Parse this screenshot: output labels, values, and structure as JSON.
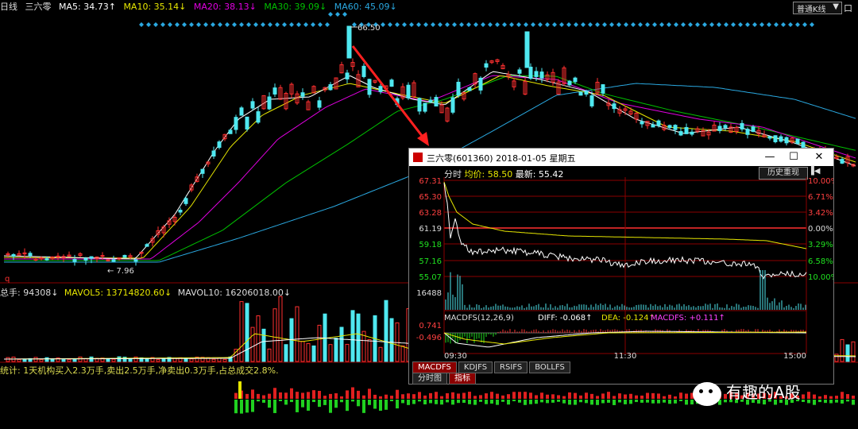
{
  "top": {
    "period": "日线",
    "name": "三六零",
    "ma5": "MA5: 34.73↑",
    "ma10": "MA10: 35.14↓",
    "ma20": "MA20: 38.13↓",
    "ma30": "MA30: 39.09↓",
    "ma60": "MA60: 45.09↓",
    "chart_mode": "普通K线",
    "chart_mode_arrow": "▼",
    "right_btn": "口"
  },
  "colors": {
    "ma5": "#ffffff",
    "ma10": "#e6e600",
    "ma20": "#e000e0",
    "ma30": "#00c000",
    "ma60": "#2aa8e0",
    "up": "#ff3030",
    "down": "#4fe8f0",
    "grid": "#8b0000"
  },
  "main_chart": {
    "high_label": "66.50",
    "low_label": "7.96",
    "marker": "q"
  },
  "volume": {
    "total": "总手: 94308↓",
    "mavol5": "MAVOL5: 13714820.60↓",
    "mavol10": "MAVOL10: 16206018.00↓"
  },
  "stats": {
    "text": "统计: 1天机构买入2.3万手,卖出2.5万手,净卖出0.3万手,占总成交2.8%."
  },
  "popup": {
    "title": "三六零(601360)  2018-01-05  星期五",
    "minimize": "—",
    "maximize": "☐",
    "close": "✕",
    "sub_prefix": "分时",
    "sub_avg": "均价: 58.50",
    "sub_last": "最新: 55.42",
    "history_btn": "历史重现",
    "history_end": "▐◀",
    "price_ticks": [
      "67.31",
      "65.30",
      "63.28",
      "61.19",
      "59.18",
      "57.16",
      "55.07"
    ],
    "pct_ticks": [
      "10.00%",
      "6.71%",
      "3.42%",
      "0.00%",
      "3.29%",
      "6.58%",
      "10.00%"
    ],
    "vol_tick": "16488",
    "macd_label": "MACDFS(12,26,9)",
    "diff": "DIFF: -0.068↑",
    "dea": "DEA: -0.124↑",
    "macdfs": "MACDFS: +0.111↑",
    "macd_hi": "0.741",
    "macd_lo": "-0.496",
    "time_ticks": [
      "09:30",
      "11:30",
      "15:00"
    ],
    "tabs": [
      "MACDFS",
      "KDJFS",
      "RSIFS",
      "BOLLFS"
    ],
    "tabs2": [
      "分时图",
      "指标"
    ]
  },
  "watermark": "有趣的A股"
}
